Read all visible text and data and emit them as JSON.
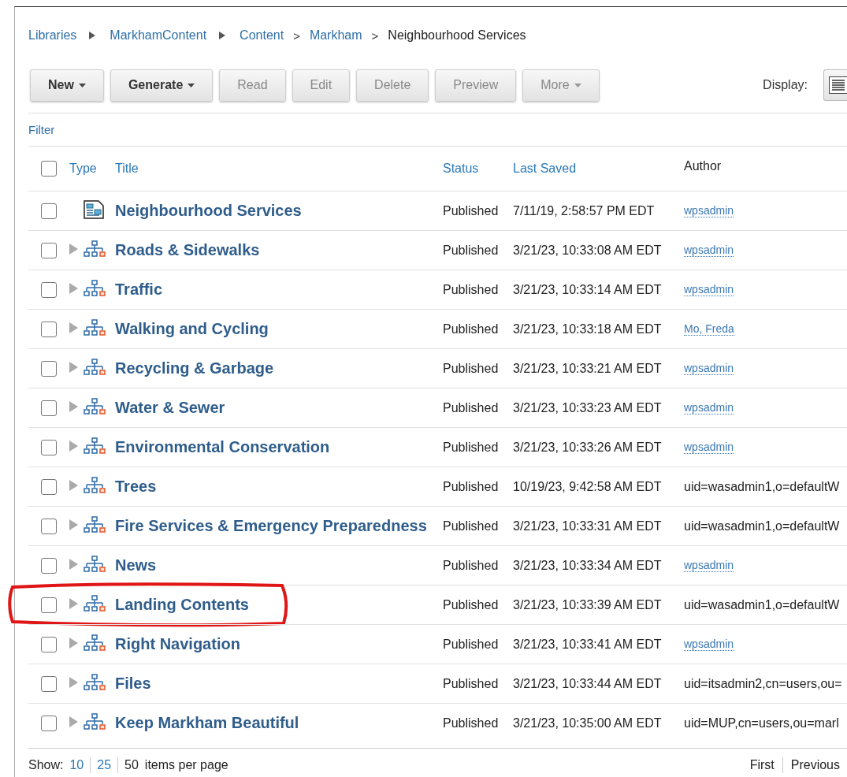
{
  "breadcrumb": [
    {
      "label": "Libraries",
      "kind": "link",
      "separator": {
        "kind": "arrow"
      }
    },
    {
      "label": "MarkhamContent",
      "kind": "link",
      "separator": {
        "kind": "arrow"
      }
    },
    {
      "label": "Content",
      "kind": "link",
      "separator": {
        "kind": "text",
        "text": ">"
      }
    },
    {
      "label": "Markham",
      "kind": "link",
      "separator": {
        "kind": "text",
        "text": ">"
      }
    },
    {
      "label": "Neighbourhood Services",
      "kind": "current"
    }
  ],
  "toolbar": {
    "buttons": [
      {
        "label": "New",
        "menu": true,
        "disabled": false
      },
      {
        "label": "Generate",
        "menu": true,
        "disabled": false
      },
      {
        "label": "Read",
        "menu": false,
        "disabled": true
      },
      {
        "label": "Edit",
        "menu": false,
        "disabled": true
      },
      {
        "label": "Delete",
        "menu": false,
        "disabled": true
      },
      {
        "label": "Preview",
        "menu": false,
        "disabled": true
      },
      {
        "label": "More",
        "menu": true,
        "disabled": true
      }
    ],
    "display_label": "Display:"
  },
  "filter": "Filter",
  "table": {
    "select_all_checked": false,
    "columns": [
      {
        "label": "Type",
        "sortable": true
      },
      {
        "label": "Title",
        "sortable": true
      },
      {
        "label": "Status",
        "sortable": true
      },
      {
        "label": "Last Saved",
        "sortable": true
      },
      {
        "label": "Author",
        "sortable": false
      }
    ],
    "rows": [
      {
        "kind": "content",
        "title": "Neighbourhood Services",
        "status": "Published",
        "saved": "7/11/19, 2:58:57 PM EDT",
        "author": {
          "kind": "link",
          "text": "wpsadmin"
        },
        "checked": false,
        "circled": false
      },
      {
        "kind": "site_area",
        "title": "Roads & Sidewalks",
        "status": "Published",
        "saved": "3/21/23, 10:33:08 AM EDT",
        "author": {
          "kind": "link",
          "text": "wpsadmin"
        },
        "checked": false,
        "circled": false
      },
      {
        "kind": "site_area",
        "title": "Traffic",
        "status": "Published",
        "saved": "3/21/23, 10:33:14 AM EDT",
        "author": {
          "kind": "link",
          "text": "wpsadmin"
        },
        "checked": false,
        "circled": false
      },
      {
        "kind": "site_area",
        "title": "Walking and Cycling",
        "status": "Published",
        "saved": "3/21/23, 10:33:18 AM EDT",
        "author": {
          "kind": "link",
          "text": "Mo, Freda"
        },
        "checked": false,
        "circled": false
      },
      {
        "kind": "site_area",
        "title": "Recycling & Garbage",
        "status": "Published",
        "saved": "3/21/23, 10:33:21 AM EDT",
        "author": {
          "kind": "link",
          "text": "wpsadmin"
        },
        "checked": false,
        "circled": false
      },
      {
        "kind": "site_area",
        "title": "Water & Sewer",
        "status": "Published",
        "saved": "3/21/23, 10:33:23 AM EDT",
        "author": {
          "kind": "link",
          "text": "wpsadmin"
        },
        "checked": false,
        "circled": false
      },
      {
        "kind": "site_area",
        "title": "Environmental Conservation",
        "status": "Published",
        "saved": "3/21/23, 10:33:26 AM EDT",
        "author": {
          "kind": "link",
          "text": "wpsadmin"
        },
        "checked": false,
        "circled": false
      },
      {
        "kind": "site_area",
        "title": "Trees",
        "status": "Published",
        "saved": "10/19/23, 9:42:58 AM EDT",
        "author": {
          "kind": "text",
          "text": "uid=wasadmin1,o=defaultW"
        },
        "checked": false,
        "circled": false
      },
      {
        "kind": "site_area",
        "title": "Fire Services & Emergency Preparedness",
        "status": "Published",
        "saved": "3/21/23, 10:33:31 AM EDT",
        "author": {
          "kind": "text",
          "text": "uid=wasadmin1,o=defaultW"
        },
        "checked": false,
        "circled": false
      },
      {
        "kind": "site_area",
        "title": "News",
        "status": "Published",
        "saved": "3/21/23, 10:33:34 AM EDT",
        "author": {
          "kind": "link",
          "text": "wpsadmin"
        },
        "checked": false,
        "circled": false
      },
      {
        "kind": "site_area",
        "title": "Landing Contents",
        "status": "Published",
        "saved": "3/21/23, 10:33:39 AM EDT",
        "author": {
          "kind": "text",
          "text": "uid=wasadmin1,o=defaultW"
        },
        "checked": false,
        "circled": true
      },
      {
        "kind": "site_area",
        "title": "Right Navigation",
        "status": "Published",
        "saved": "3/21/23, 10:33:41 AM EDT",
        "author": {
          "kind": "link",
          "text": "wpsadmin"
        },
        "checked": false,
        "circled": false
      },
      {
        "kind": "site_area",
        "title": "Files",
        "status": "Published",
        "saved": "3/21/23, 10:33:44 AM EDT",
        "author": {
          "kind": "text",
          "text": "uid=itsadmin2,cn=users,ou="
        },
        "checked": false,
        "circled": false
      },
      {
        "kind": "site_area",
        "title": "Keep Markham Beautiful",
        "status": "Published",
        "saved": "3/21/23, 10:35:00 AM EDT",
        "author": {
          "kind": "text",
          "text": "uid=MUP,cn=users,ou=marl"
        },
        "checked": false,
        "circled": false
      }
    ]
  },
  "footer": {
    "show_label": "Show:",
    "page_sizes": [
      {
        "label": "10",
        "selected": false
      },
      {
        "label": "25",
        "selected": false
      },
      {
        "label": "50",
        "selected": true
      }
    ],
    "per_page_label": "items per page",
    "pager": [
      "First",
      "Previous"
    ]
  }
}
